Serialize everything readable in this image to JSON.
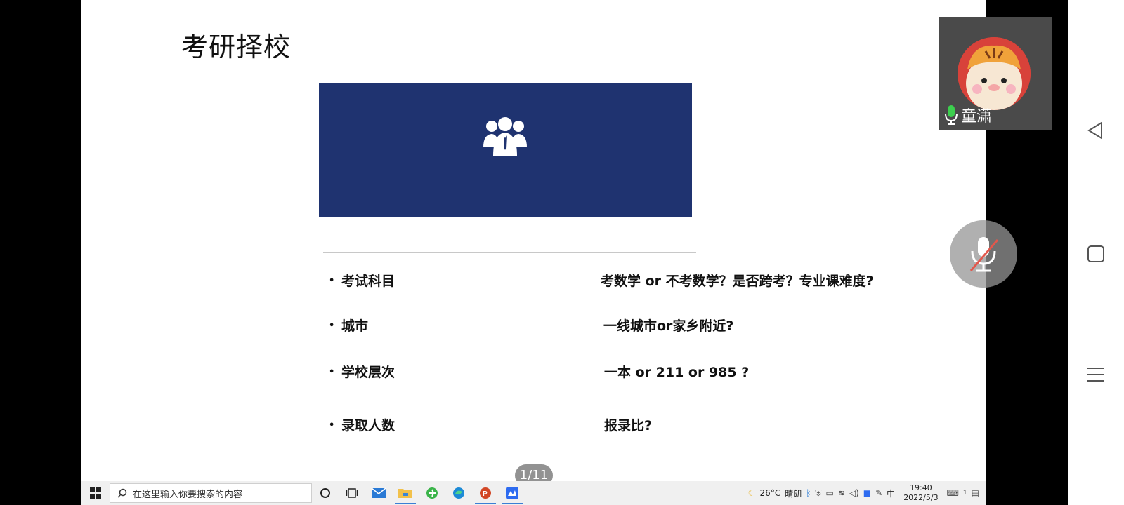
{
  "slide": {
    "title": "考研择校",
    "rows": [
      {
        "bullet": "•",
        "label": "考试科目",
        "value": "考数学 or 不考数学？是否跨考？专业课难度?"
      },
      {
        "bullet": "•",
        "label": "城市",
        "value": "一线城市or家乡附近?"
      },
      {
        "bullet": "•",
        "label": "学校层次",
        "value": "一本 or 211 or 985 ?"
      },
      {
        "bullet": "•",
        "label": "录取人数",
        "value": "报录比?"
      }
    ],
    "banner_color": "#1f3370",
    "banner_icon": "team-icon"
  },
  "page_indicator": "1/11",
  "video": {
    "participant_name": "童潇",
    "mic_icon": "microphone-icon"
  },
  "mute_button": {
    "icon": "microphone-muted-icon"
  },
  "android_nav": {
    "back": "back-icon",
    "home": "home-icon",
    "menu": "menu-icon"
  },
  "taskbar": {
    "search_placeholder": "在这里输入你要搜索的内容",
    "apps": [
      "cortana-icon",
      "task-view-icon",
      "mail-icon",
      "file-explorer-icon",
      "browser-icon",
      "edge-icon",
      "powerpoint-icon",
      "meeting-app-icon"
    ],
    "weather": {
      "temp": "26°C",
      "condition": "晴朗"
    },
    "ime": "中",
    "time": "19:40",
    "date": "2022/5/3",
    "notification_count": "1"
  }
}
